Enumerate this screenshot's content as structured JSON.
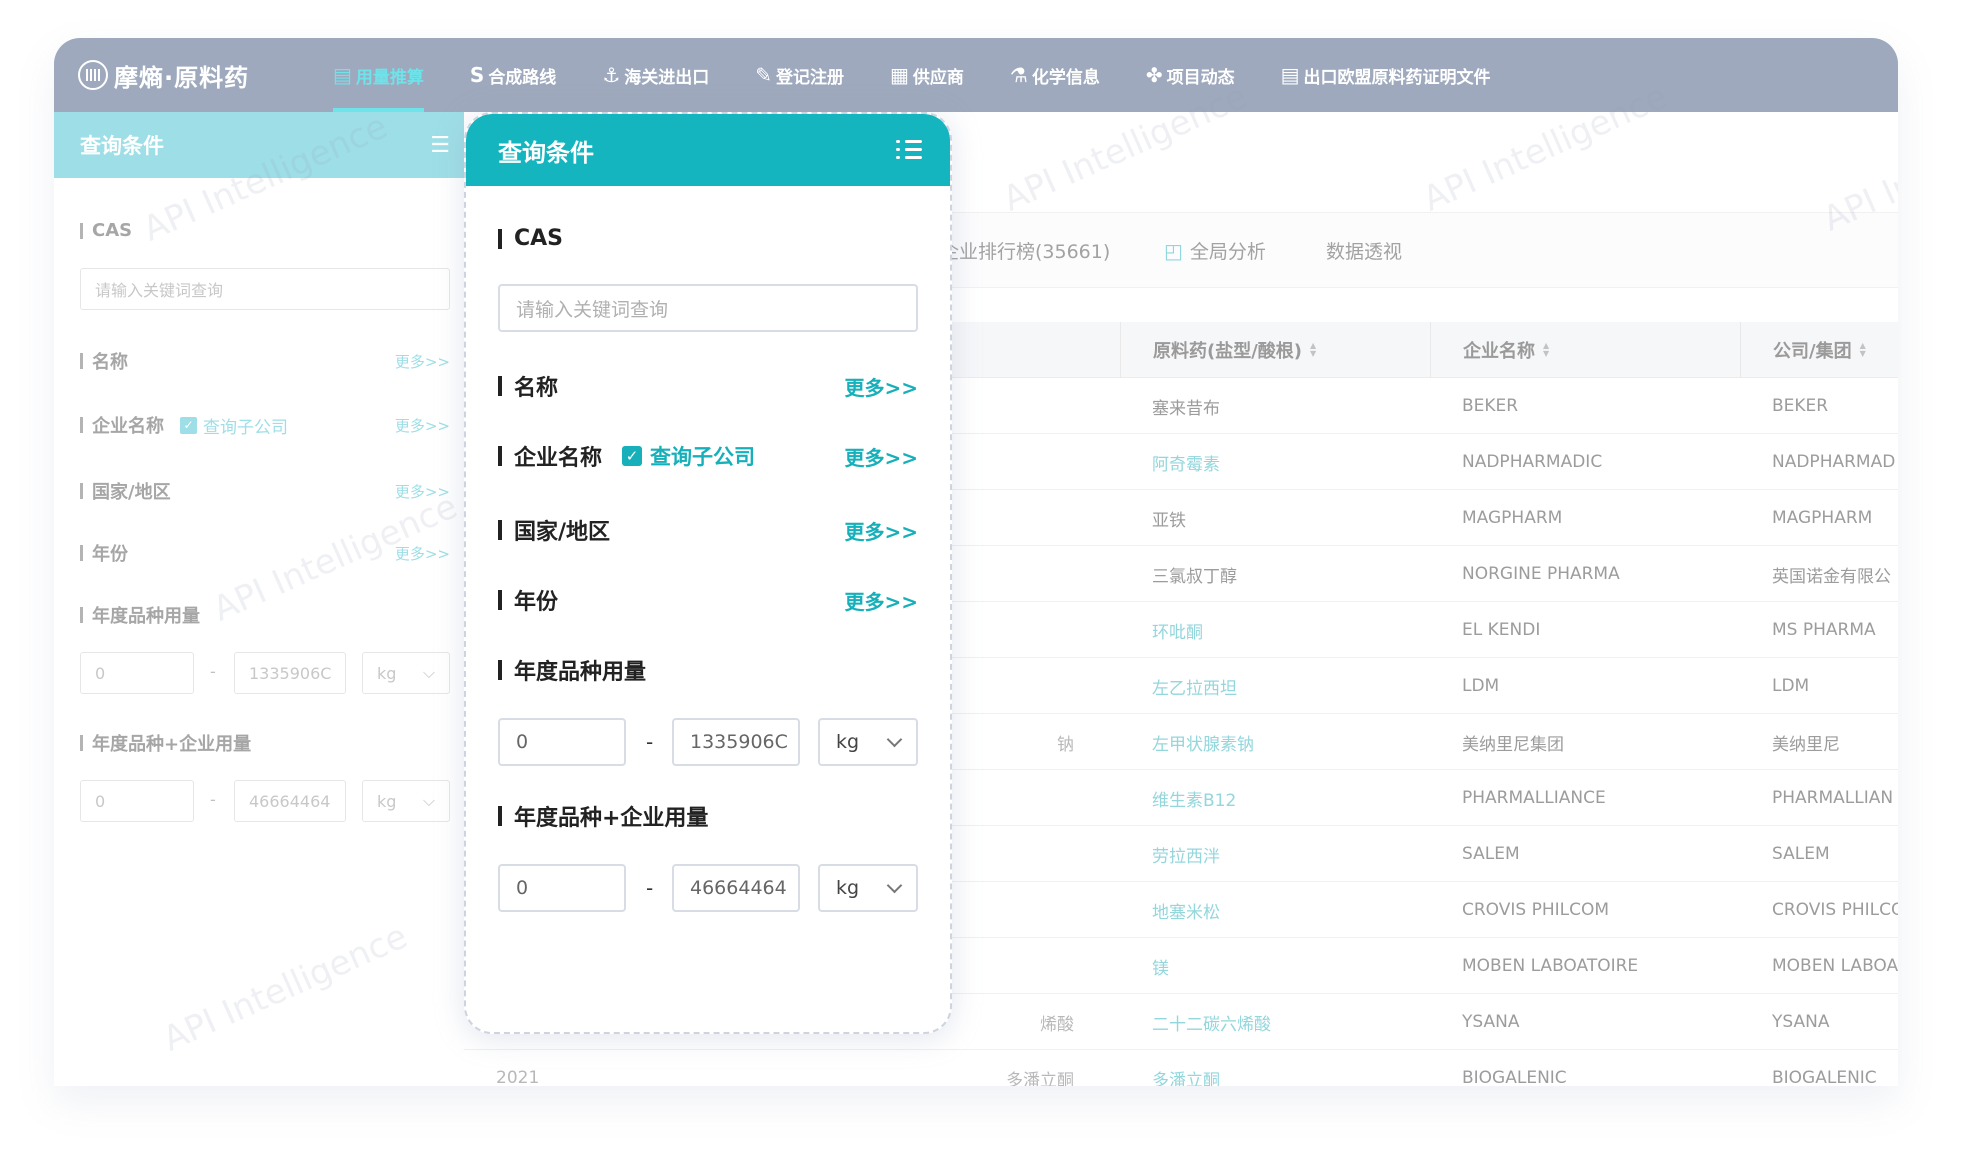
{
  "brand": {
    "name": "摩熵·原料药"
  },
  "nav": [
    {
      "icon": "▤",
      "label": "用量推算",
      "active": true
    },
    {
      "icon": "S",
      "label": "合成路线"
    },
    {
      "icon": "⚓",
      "label": "海关进出口"
    },
    {
      "icon": "✎",
      "label": "登记注册"
    },
    {
      "icon": "▦",
      "label": "供应商"
    },
    {
      "icon": "⚗",
      "label": "化学信息"
    },
    {
      "icon": "✤",
      "label": "项目动态"
    },
    {
      "icon": "▤",
      "label": "出口欧盟原料药证明文件"
    }
  ],
  "watermark": "API Intelligence",
  "bg_sidebar": {
    "title": "查询条件",
    "cas_label": "CAS",
    "search_placeholder": "请输入关键词查询",
    "name_label": "名称",
    "company_label": "企业名称",
    "subsidiary_label": "查询子公司",
    "country_label": "国家/地区",
    "year_label": "年份",
    "more_label": "更多>>",
    "annual_label": "年度品种用量",
    "annual_min": "0",
    "annual_max": "1335906C",
    "annual_unit": "kg",
    "annual_company_label": "年度品种+企业用量",
    "ac_min": "0",
    "ac_max": "46664464",
    "ac_unit": "kg"
  },
  "tabs": [
    {
      "label": "企业排行榜(35661)"
    },
    {
      "label": "全局分析",
      "icon": "chart-icon"
    },
    {
      "label": "数据透视"
    }
  ],
  "table": {
    "headers": [
      "原料药(盐型/酸根)",
      "企业名称",
      "公司/集团"
    ],
    "rows": [
      {
        "drug": "塞来昔布",
        "company": "BEKER",
        "group": "BEKER",
        "link": false
      },
      {
        "drug": "阿奇霉素",
        "company": "NADPHARMADIC",
        "group": "NADPHARMAD",
        "link": true
      },
      {
        "drug": "亚铁",
        "company": "MAGPHARM",
        "group": "MAGPHARM",
        "link": false
      },
      {
        "drug": "三氯叔丁醇",
        "company": "NORGINE PHARMA",
        "group": "英国诺金有限公",
        "link": false
      },
      {
        "drug": "环吡酮",
        "company": "EL KENDI",
        "group": "MS PHARMA",
        "link": true
      },
      {
        "drug": "左乙拉西坦",
        "company": "LDM",
        "group": "LDM",
        "link": true
      },
      {
        "drug": "左甲状腺素钠",
        "company": "美纳里尼集团",
        "group": "美纳里尼",
        "link": true,
        "left": "钠"
      },
      {
        "drug": "维生素B12",
        "company": "PHARMALLIANCE",
        "group": "PHARMALLIAN",
        "link": true
      },
      {
        "drug": "劳拉西泮",
        "company": "SALEM",
        "group": "SALEM",
        "link": true
      },
      {
        "drug": "地塞米松",
        "company": "CROVIS PHILCOM",
        "group": "CROVIS PHILCO",
        "link": true
      },
      {
        "drug": "镁",
        "company": "MOBEN LABOATOIRE",
        "group": "MOBEN LABOA",
        "link": true
      },
      {
        "drug": "二十二碳六烯酸",
        "company": "YSANA",
        "group": "YSANA",
        "link": true,
        "left": "烯酸"
      },
      {
        "drug": "多潘立酮",
        "company": "BIOGALENIC",
        "group": "BIOGALENIC",
        "link": true,
        "left": "多潘立酮",
        "leftyear": "2021"
      }
    ]
  },
  "panel": {
    "title": "查询条件",
    "cas_label": "CAS",
    "search_placeholder": "请输入关键词查询",
    "name_label": "名称",
    "company_label": "企业名称",
    "subsidiary_label": "查询子公司",
    "country_label": "国家/地区",
    "year_label": "年份",
    "more_label": "更多>>",
    "annual_label": "年度品种用量",
    "annual_min": "0",
    "annual_max": "1335906C",
    "annual_unit": "kg",
    "annual_company_label": "年度品种+企业用量",
    "ac_min": "0",
    "ac_max": "46664464",
    "ac_unit": "kg"
  }
}
